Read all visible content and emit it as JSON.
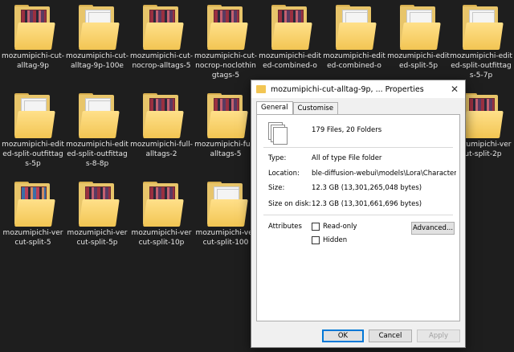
{
  "folders": [
    {
      "label": "mozumipichi-cut-alltag-9p",
      "thumb": "photos"
    },
    {
      "label": "mozumipichi-cut-alltag-9p-100e",
      "thumb": "papers"
    },
    {
      "label": "mozumipichi-cut-nocrop-alltags-5",
      "thumb": "photos"
    },
    {
      "label": "mozumipichi-cut-nocrop-noclothingtags-5",
      "thumb": "photos"
    },
    {
      "label": "mozumipichi-edited-combined-o",
      "thumb": "photos"
    },
    {
      "label": "mozumipichi-edited-combined-o",
      "thumb": "papers"
    },
    {
      "label": "mozumipichi-edited-split-5p",
      "thumb": "papers"
    },
    {
      "label": "mozumipichi-edited-split-outfittags-5-7p",
      "thumb": "papers"
    },
    {
      "label": "mozumipichi-edited-split-outfittags-5p",
      "thumb": "papers"
    },
    {
      "label": "mozumipichi-edited-split-outfittags-8-8p",
      "thumb": "papers"
    },
    {
      "label": "mozumipichi-full-alltags-2",
      "thumb": "photos"
    },
    {
      "label": "mozumipichi-full-alltags-5",
      "thumb": "photos"
    },
    {
      "label": "mozumipichi-vercut-split-2p",
      "thumb": "photos"
    },
    {
      "label": "mozumipichi-vercut-split-5",
      "thumb": "photos2"
    },
    {
      "label": "mozumipichi-vercut-split-5p",
      "thumb": "photos"
    },
    {
      "label": "mozumipichi-vercut-split-10p",
      "thumb": "photos"
    },
    {
      "label": "mozumipichi-vercut-split-100",
      "thumb": "papers"
    }
  ],
  "dialog": {
    "title": "mozumipichi-cut-alltag-9p, ... Properties",
    "close": "✕",
    "tabs": [
      "General",
      "Customise"
    ],
    "count": "179 Files, 20 Folders",
    "type_label": "Type:",
    "type_value": "All of type File folder",
    "location_label": "Location:",
    "location_value": "ble-diffusion-webui\\models\\Lora\\Characters\\mozu",
    "size_label": "Size:",
    "size_value": "12.3 GB (13,301,265,048 bytes)",
    "disk_label": "Size on disk:",
    "disk_value": "12.3 GB (13,301,661,696 bytes)",
    "attributes_label": "Attributes",
    "readonly_label": "Read-only",
    "hidden_label": "Hidden",
    "advanced_label": "Advanced...",
    "ok_label": "OK",
    "cancel_label": "Cancel",
    "apply_label": "Apply"
  }
}
